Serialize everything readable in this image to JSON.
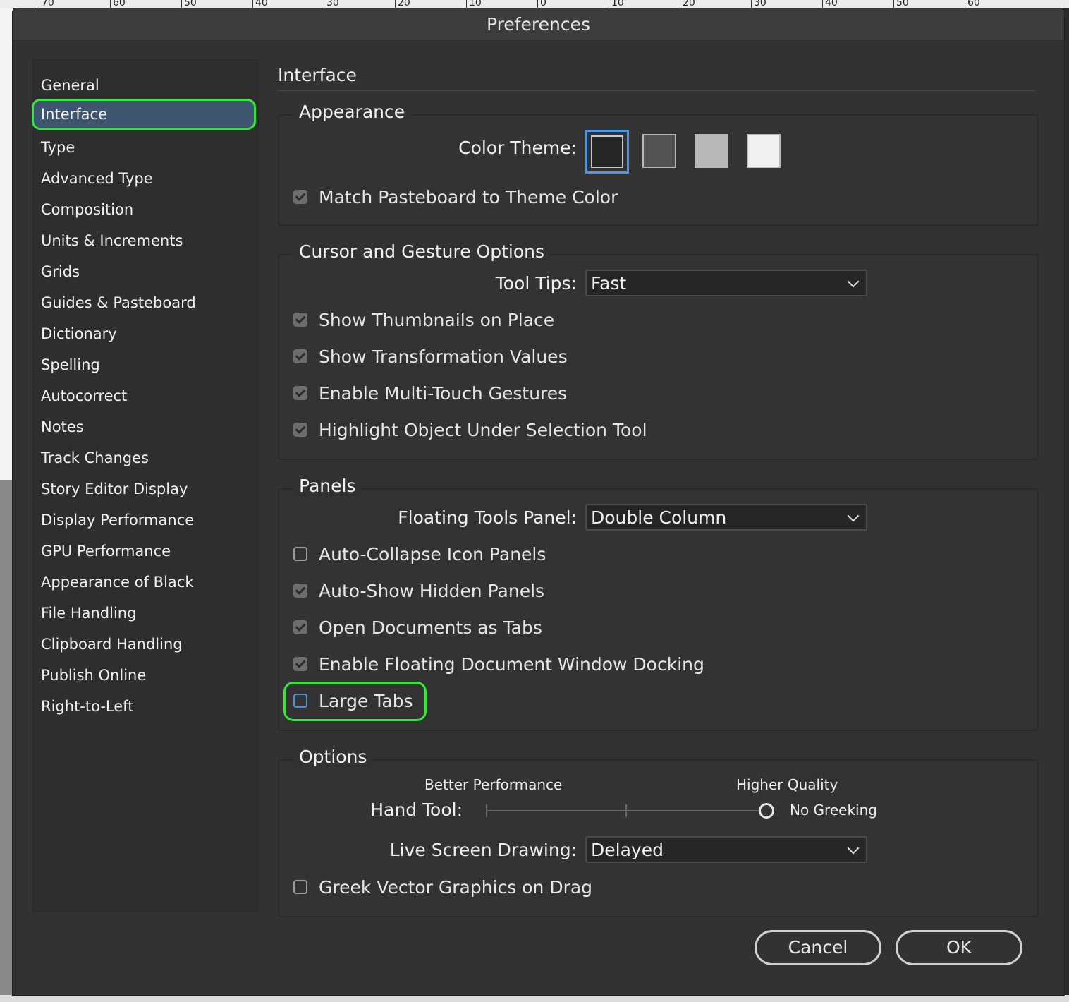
{
  "ruler": [
    "70",
    "60",
    "50",
    "40",
    "30",
    "20",
    "10",
    "0",
    "10",
    "20",
    "30",
    "40",
    "50",
    "60"
  ],
  "dialog": {
    "title": "Preferences"
  },
  "sidebar": {
    "items": [
      {
        "label": "General"
      },
      {
        "label": "Interface",
        "selected": true
      },
      {
        "label": "Type"
      },
      {
        "label": "Advanced Type"
      },
      {
        "label": "Composition"
      },
      {
        "label": "Units & Increments"
      },
      {
        "label": "Grids"
      },
      {
        "label": "Guides & Pasteboard"
      },
      {
        "label": "Dictionary"
      },
      {
        "label": "Spelling"
      },
      {
        "label": "Autocorrect"
      },
      {
        "label": "Notes"
      },
      {
        "label": "Track Changes"
      },
      {
        "label": "Story Editor Display"
      },
      {
        "label": "Display Performance"
      },
      {
        "label": "GPU Performance"
      },
      {
        "label": "Appearance of Black"
      },
      {
        "label": "File Handling"
      },
      {
        "label": "Clipboard Handling"
      },
      {
        "label": "Publish Online"
      },
      {
        "label": "Right-to-Left"
      }
    ]
  },
  "main": {
    "heading": "Interface",
    "appearance": {
      "title": "Appearance",
      "color_theme_label": "Color Theme:",
      "themes": [
        {
          "name": "dark",
          "color": "#262626",
          "selected": true
        },
        {
          "name": "medium-dark",
          "color": "#535353"
        },
        {
          "name": "medium-light",
          "color": "#b8b8b8"
        },
        {
          "name": "light",
          "color": "#f0f0f0"
        }
      ],
      "match_pasteboard": {
        "label": "Match Pasteboard to Theme Color",
        "checked": true
      }
    },
    "cursor": {
      "title": "Cursor and Gesture Options",
      "tool_tips_label": "Tool Tips:",
      "tool_tips_value": "Fast",
      "checks": [
        {
          "label": "Show Thumbnails on Place",
          "checked": true
        },
        {
          "label": "Show Transformation Values",
          "checked": true
        },
        {
          "label": "Enable Multi-Touch Gestures",
          "checked": true
        },
        {
          "label": "Highlight Object Under Selection Tool",
          "checked": true
        }
      ]
    },
    "panels": {
      "title": "Panels",
      "floating_tools_label": "Floating Tools Panel:",
      "floating_tools_value": "Double Column",
      "checks": [
        {
          "label": "Auto-Collapse Icon Panels",
          "checked": false
        },
        {
          "label": "Auto-Show Hidden Panels",
          "checked": true
        },
        {
          "label": "Open Documents as Tabs",
          "checked": true
        },
        {
          "label": "Enable Floating Document Window Docking",
          "checked": true
        },
        {
          "label": "Large Tabs",
          "checked": false,
          "focused": true
        }
      ]
    },
    "options": {
      "title": "Options",
      "better_performance": "Better Performance",
      "higher_quality": "Higher Quality",
      "hand_tool_label": "Hand Tool:",
      "hand_tool_value": "No Greeking",
      "hand_tool_level": 1.0,
      "live_screen_label": "Live Screen Drawing:",
      "live_screen_value": "Delayed",
      "greek_vector": {
        "label": "Greek Vector Graphics on Drag",
        "checked": false
      }
    }
  },
  "buttons": {
    "cancel": "Cancel",
    "ok": "OK"
  }
}
